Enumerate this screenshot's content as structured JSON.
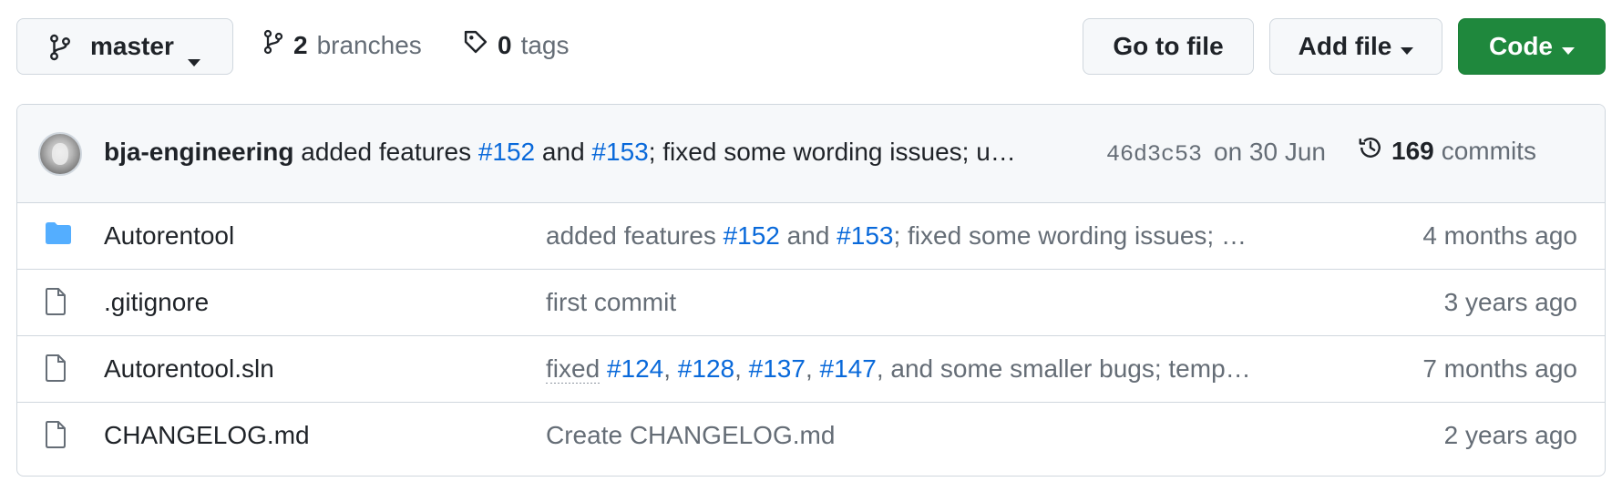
{
  "topbar": {
    "branch": {
      "name": "master"
    },
    "branches": {
      "count": "2",
      "label": "branches"
    },
    "tags": {
      "count": "0",
      "label": "tags"
    },
    "goto_label": "Go to file",
    "add_label": "Add file",
    "code_label": "Code"
  },
  "commit": {
    "author": "bja-engineering",
    "text1": "added features",
    "ref1": "#152",
    "text2": "and",
    "ref2": "#153",
    "text3": "; fixed some wording issues; upd...",
    "sha": "46d3c53",
    "date": "on 30 Jun",
    "commits_count": "169",
    "commits_label": "commits"
  },
  "files": [
    {
      "name": "Autorentool",
      "type": "folder",
      "msg": {
        "t1": "added features",
        "r1": "#152",
        "t2": "and",
        "r2": "#153",
        "t3": "; fixed some wording issues; update..."
      },
      "age": "4 months ago"
    },
    {
      "name": ".gitignore",
      "type": "file",
      "msg": {
        "t1": "first commit"
      },
      "age": "3 years ago"
    },
    {
      "name": "Autorentool.sln",
      "type": "file",
      "msg": {
        "t1": "fixed",
        "r1": "#124",
        "r2": "#128",
        "r3": "#137",
        "r4": "#147",
        "t2": ", and some smaller bugs; temporarily ..."
      },
      "age": "7 months ago"
    },
    {
      "name": "CHANGELOG.md",
      "type": "file",
      "msg": {
        "t1": "Create CHANGELOG.md"
      },
      "age": "2 years ago"
    }
  ],
  "colors": {
    "accent_link": "#0969da",
    "primary_button": "#1f883d",
    "folder_icon": "#54aeff",
    "muted_text": "#656d76"
  },
  "icons": [
    "git-branch-icon",
    "tag-icon",
    "history-icon",
    "folder-icon",
    "file-icon",
    "caret-down-icon"
  ]
}
